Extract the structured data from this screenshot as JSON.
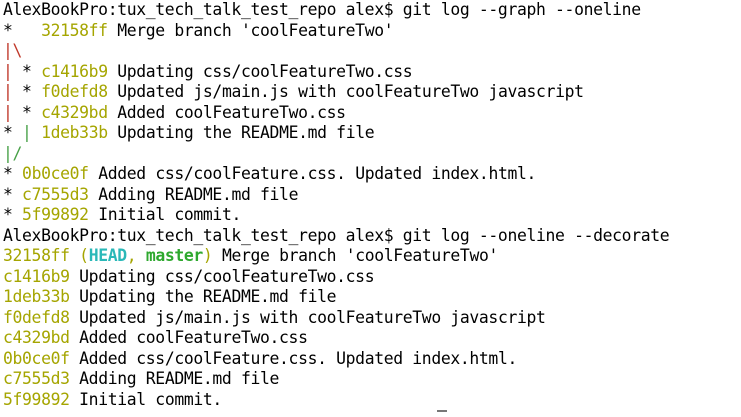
{
  "colors": {
    "text": "#000000",
    "hash": "#a5a500",
    "graph_red": "#c0392b",
    "graph_green": "#47a047",
    "head": "#2ab8b8",
    "master": "#2ea82e",
    "cursor": "#777777"
  },
  "terminal": {
    "lines": [
      {
        "segments": [
          {
            "text": "AlexBookPro:tux_tech_talk_test_repo alex$ git log --graph --oneline",
            "style": "text"
          }
        ]
      },
      {
        "segments": [
          {
            "text": "*   ",
            "style": "text"
          },
          {
            "text": "32158ff",
            "style": "hash"
          },
          {
            "text": " Merge branch 'coolFeatureTwo'",
            "style": "text"
          }
        ]
      },
      {
        "segments": [
          {
            "text": "|\\",
            "style": "graph_red"
          }
        ]
      },
      {
        "segments": [
          {
            "text": "|",
            "style": "graph_red"
          },
          {
            "text": " * ",
            "style": "text"
          },
          {
            "text": "c1416b9",
            "style": "hash"
          },
          {
            "text": " Updating css/coolFeatureTwo.css",
            "style": "text"
          }
        ]
      },
      {
        "segments": [
          {
            "text": "|",
            "style": "graph_red"
          },
          {
            "text": " * ",
            "style": "text"
          },
          {
            "text": "f0defd8",
            "style": "hash"
          },
          {
            "text": " Updated js/main.js with coolFeatureTwo javascript",
            "style": "text"
          }
        ]
      },
      {
        "segments": [
          {
            "text": "|",
            "style": "graph_red"
          },
          {
            "text": " * ",
            "style": "text"
          },
          {
            "text": "c4329bd",
            "style": "hash"
          },
          {
            "text": " Added coolFeatureTwo.css",
            "style": "text"
          }
        ]
      },
      {
        "segments": [
          {
            "text": "* ",
            "style": "text"
          },
          {
            "text": "|",
            "style": "graph_green"
          },
          {
            "text": " ",
            "style": "text"
          },
          {
            "text": "1deb33b",
            "style": "hash"
          },
          {
            "text": " Updating the README.md file",
            "style": "text"
          }
        ]
      },
      {
        "segments": [
          {
            "text": "|/",
            "style": "graph_green"
          }
        ]
      },
      {
        "segments": [
          {
            "text": "* ",
            "style": "text"
          },
          {
            "text": "0b0ce0f",
            "style": "hash"
          },
          {
            "text": " Added css/coolFeature.css. Updated index.html.",
            "style": "text"
          }
        ]
      },
      {
        "segments": [
          {
            "text": "* ",
            "style": "text"
          },
          {
            "text": "c7555d3",
            "style": "hash"
          },
          {
            "text": " Adding README.md file",
            "style": "text"
          }
        ]
      },
      {
        "segments": [
          {
            "text": "* ",
            "style": "text"
          },
          {
            "text": "5f99892",
            "style": "hash"
          },
          {
            "text": " Initial commit.",
            "style": "text"
          }
        ]
      },
      {
        "segments": [
          {
            "text": "AlexBookPro:tux_tech_talk_test_repo alex$ git log --oneline --decorate",
            "style": "text"
          }
        ]
      },
      {
        "segments": [
          {
            "text": "32158ff",
            "style": "hash"
          },
          {
            "text": " (",
            "style": "hash"
          },
          {
            "text": "HEAD",
            "style": "head"
          },
          {
            "text": ", ",
            "style": "hash"
          },
          {
            "text": "master",
            "style": "master"
          },
          {
            "text": ")",
            "style": "hash"
          },
          {
            "text": " Merge branch 'coolFeatureTwo'",
            "style": "text"
          }
        ]
      },
      {
        "segments": [
          {
            "text": "c1416b9",
            "style": "hash"
          },
          {
            "text": " Updating css/coolFeatureTwo.css",
            "style": "text"
          }
        ]
      },
      {
        "segments": [
          {
            "text": "1deb33b",
            "style": "hash"
          },
          {
            "text": " Updating the README.md file",
            "style": "text"
          }
        ]
      },
      {
        "segments": [
          {
            "text": "f0defd8",
            "style": "hash"
          },
          {
            "text": " Updated js/main.js with coolFeatureTwo javascript",
            "style": "text"
          }
        ]
      },
      {
        "segments": [
          {
            "text": "c4329bd",
            "style": "hash"
          },
          {
            "text": " Added coolFeatureTwo.css",
            "style": "text"
          }
        ]
      },
      {
        "segments": [
          {
            "text": "0b0ce0f",
            "style": "hash"
          },
          {
            "text": " Added css/coolFeature.css. Updated index.html.",
            "style": "text"
          }
        ]
      },
      {
        "segments": [
          {
            "text": "c7555d3",
            "style": "hash"
          },
          {
            "text": " Adding README.md file",
            "style": "text"
          }
        ]
      },
      {
        "segments": [
          {
            "text": "5f99892",
            "style": "hash"
          },
          {
            "text": " Initial commit.",
            "style": "text"
          }
        ]
      }
    ]
  }
}
